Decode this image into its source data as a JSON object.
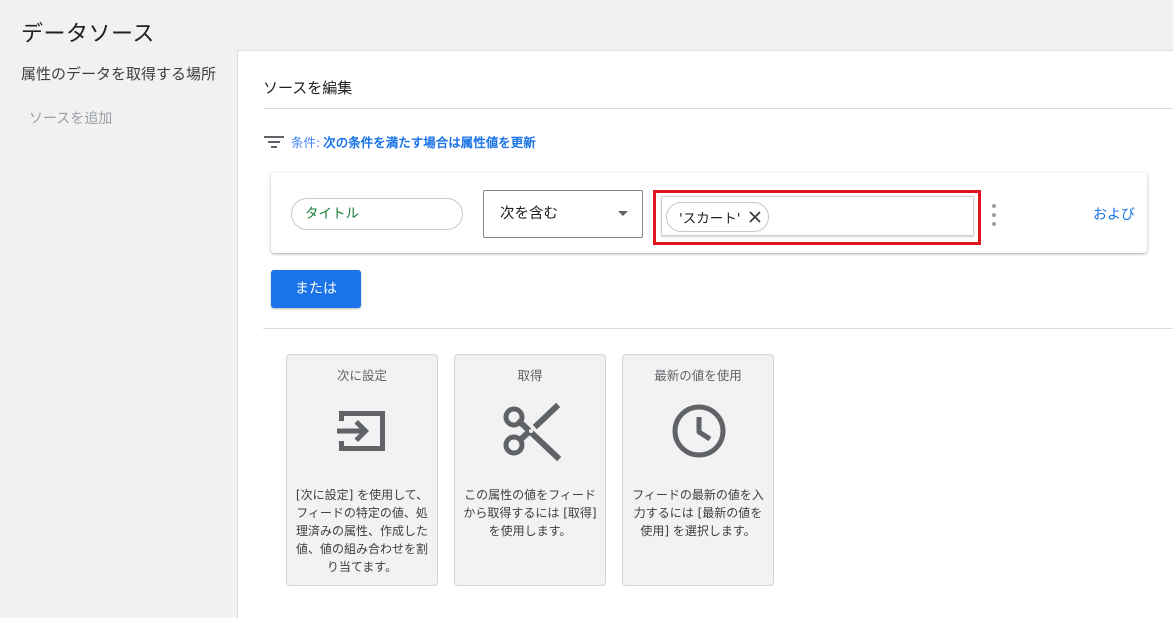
{
  "page": {
    "title": "データソース"
  },
  "sidebar": {
    "heading": "属性のデータを取得する場所",
    "add_source": "ソースを追加"
  },
  "editor": {
    "title": "ソースを編集",
    "condition_prefix": "条件:",
    "condition_text": "次の条件を満たす場合は属性値を更新",
    "rule": {
      "attribute": "タイトル",
      "operator": "次を含む",
      "value_chip": "'スカート'",
      "and_label": "および"
    },
    "or_button": "または"
  },
  "actions": [
    {
      "title": "次に設定",
      "icon": "input-arrow-icon",
      "description": "[次に設定] を使用して、フィードの特定の値、処理済みの属性、作成した値、値の組み合わせを割り当てます。"
    },
    {
      "title": "取得",
      "icon": "scissors-icon",
      "description": "この属性の値をフィードから取得するには [取得] を使用します。"
    },
    {
      "title": "最新の値を使用",
      "icon": "clock-icon",
      "description": "フィードの最新の値を入力するには [最新の値を使用] を選択します。"
    }
  ],
  "colors": {
    "accent": "#1a73e8",
    "highlight": "#e0141e",
    "attribute_text": "#188038"
  }
}
